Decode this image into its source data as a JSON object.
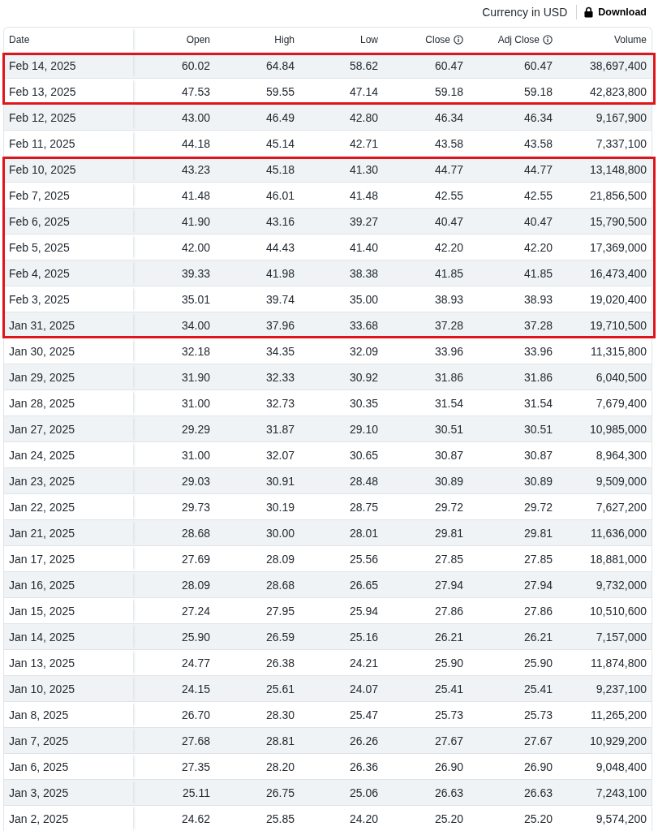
{
  "toolbar": {
    "currency": "Currency in USD",
    "download": "Download"
  },
  "table": {
    "columns": [
      {
        "label": "Date",
        "info": false
      },
      {
        "label": "Open",
        "info": false
      },
      {
        "label": "High",
        "info": false
      },
      {
        "label": "Low",
        "info": false
      },
      {
        "label": "Close",
        "info": true
      },
      {
        "label": "Adj Close",
        "info": true
      },
      {
        "label": "Volume",
        "info": false
      }
    ],
    "rows": [
      {
        "cells": [
          "Feb 14, 2025",
          "60.02",
          "64.84",
          "58.62",
          "60.47",
          "60.47",
          "38,697,400"
        ],
        "highlighted": true
      },
      {
        "cells": [
          "Feb 13, 2025",
          "47.53",
          "59.55",
          "47.14",
          "59.18",
          "59.18",
          "42,823,800"
        ],
        "highlighted": true
      },
      {
        "cells": [
          "Feb 12, 2025",
          "43.00",
          "46.49",
          "42.80",
          "46.34",
          "46.34",
          "9,167,900"
        ],
        "highlighted": false
      },
      {
        "cells": [
          "Feb 11, 2025",
          "44.18",
          "45.14",
          "42.71",
          "43.58",
          "43.58",
          "7,337,100"
        ],
        "highlighted": false
      },
      {
        "cells": [
          "Feb 10, 2025",
          "43.23",
          "45.18",
          "41.30",
          "44.77",
          "44.77",
          "13,148,800"
        ],
        "highlighted": true
      },
      {
        "cells": [
          "Feb 7, 2025",
          "41.48",
          "46.01",
          "41.48",
          "42.55",
          "42.55",
          "21,856,500"
        ],
        "highlighted": true
      },
      {
        "cells": [
          "Feb 6, 2025",
          "41.90",
          "43.16",
          "39.27",
          "40.47",
          "40.47",
          "15,790,500"
        ],
        "highlighted": true
      },
      {
        "cells": [
          "Feb 5, 2025",
          "42.00",
          "44.43",
          "41.40",
          "42.20",
          "42.20",
          "17,369,000"
        ],
        "highlighted": true
      },
      {
        "cells": [
          "Feb 4, 2025",
          "39.33",
          "41.98",
          "38.38",
          "41.85",
          "41.85",
          "16,473,400"
        ],
        "highlighted": true
      },
      {
        "cells": [
          "Feb 3, 2025",
          "35.01",
          "39.74",
          "35.00",
          "38.93",
          "38.93",
          "19,020,400"
        ],
        "highlighted": true
      },
      {
        "cells": [
          "Jan 31, 2025",
          "34.00",
          "37.96",
          "33.68",
          "37.28",
          "37.28",
          "19,710,500"
        ],
        "highlighted": true
      },
      {
        "cells": [
          "Jan 30, 2025",
          "32.18",
          "34.35",
          "32.09",
          "33.96",
          "33.96",
          "11,315,800"
        ],
        "highlighted": false
      },
      {
        "cells": [
          "Jan 29, 2025",
          "31.90",
          "32.33",
          "30.92",
          "31.86",
          "31.86",
          "6,040,500"
        ],
        "highlighted": false
      },
      {
        "cells": [
          "Jan 28, 2025",
          "31.00",
          "32.73",
          "30.35",
          "31.54",
          "31.54",
          "7,679,400"
        ],
        "highlighted": false
      },
      {
        "cells": [
          "Jan 27, 2025",
          "29.29",
          "31.87",
          "29.10",
          "30.51",
          "30.51",
          "10,985,000"
        ],
        "highlighted": false
      },
      {
        "cells": [
          "Jan 24, 2025",
          "31.00",
          "32.07",
          "30.65",
          "30.87",
          "30.87",
          "8,964,300"
        ],
        "highlighted": false
      },
      {
        "cells": [
          "Jan 23, 2025",
          "29.03",
          "30.91",
          "28.48",
          "30.89",
          "30.89",
          "9,509,000"
        ],
        "highlighted": false
      },
      {
        "cells": [
          "Jan 22, 2025",
          "29.73",
          "30.19",
          "28.75",
          "29.72",
          "29.72",
          "7,627,200"
        ],
        "highlighted": false
      },
      {
        "cells": [
          "Jan 21, 2025",
          "28.68",
          "30.00",
          "28.01",
          "29.81",
          "29.81",
          "11,636,000"
        ],
        "highlighted": false
      },
      {
        "cells": [
          "Jan 17, 2025",
          "27.69",
          "28.09",
          "25.56",
          "27.85",
          "27.85",
          "18,881,000"
        ],
        "highlighted": false
      },
      {
        "cells": [
          "Jan 16, 2025",
          "28.09",
          "28.68",
          "26.65",
          "27.94",
          "27.94",
          "9,732,000"
        ],
        "highlighted": false
      },
      {
        "cells": [
          "Jan 15, 2025",
          "27.24",
          "27.95",
          "25.94",
          "27.86",
          "27.86",
          "10,510,600"
        ],
        "highlighted": false
      },
      {
        "cells": [
          "Jan 14, 2025",
          "25.90",
          "26.59",
          "25.16",
          "26.21",
          "26.21",
          "7,157,000"
        ],
        "highlighted": false
      },
      {
        "cells": [
          "Jan 13, 2025",
          "24.77",
          "26.38",
          "24.21",
          "25.90",
          "25.90",
          "11,874,800"
        ],
        "highlighted": false
      },
      {
        "cells": [
          "Jan 10, 2025",
          "24.15",
          "25.61",
          "24.07",
          "25.41",
          "25.41",
          "9,237,100"
        ],
        "highlighted": false
      },
      {
        "cells": [
          "Jan 8, 2025",
          "26.70",
          "28.30",
          "25.47",
          "25.73",
          "25.73",
          "11,265,200"
        ],
        "highlighted": false
      },
      {
        "cells": [
          "Jan 7, 2025",
          "27.68",
          "28.81",
          "26.26",
          "27.67",
          "27.67",
          "10,929,200"
        ],
        "highlighted": false
      },
      {
        "cells": [
          "Jan 6, 2025",
          "27.35",
          "28.20",
          "26.36",
          "26.90",
          "26.90",
          "9,048,400"
        ],
        "highlighted": false
      },
      {
        "cells": [
          "Jan 3, 2025",
          "25.11",
          "26.75",
          "25.06",
          "26.63",
          "26.63",
          "7,243,100"
        ],
        "highlighted": false
      },
      {
        "cells": [
          "Jan 2, 2025",
          "24.62",
          "25.85",
          "24.20",
          "25.20",
          "25.20",
          "9,574,200"
        ],
        "highlighted": false
      }
    ]
  }
}
